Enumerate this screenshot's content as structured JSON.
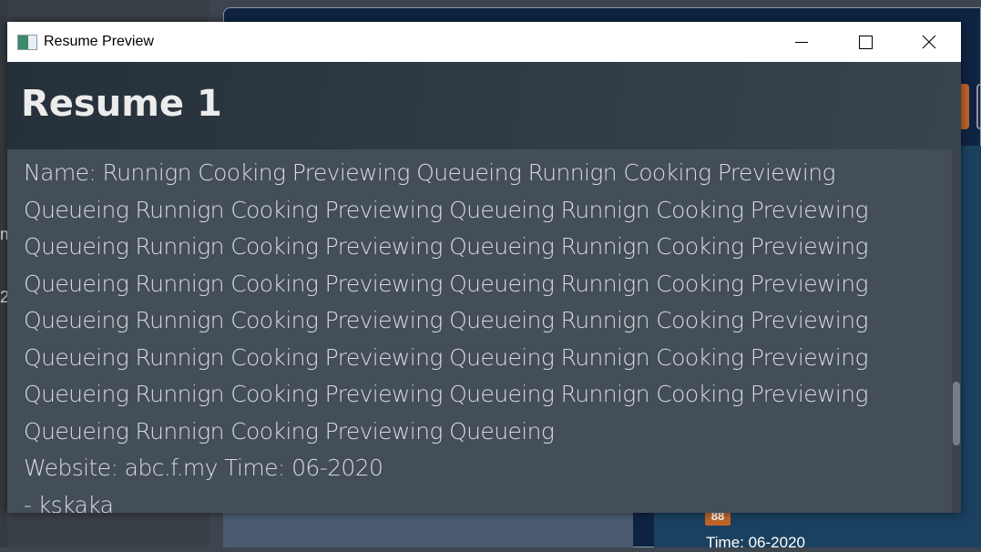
{
  "window": {
    "title": "Resume Preview",
    "minimize": "minimize",
    "maximize": "maximize",
    "close": "close"
  },
  "header": {
    "title": "Resume 1"
  },
  "content": {
    "lines": [
      "Name: Runnign Cooking Previewing Queueing Runnign Cooking Previewing",
      "Queueing Runnign Cooking Previewing Queueing Runnign Cooking Previewing",
      "Queueing Runnign Cooking Previewing Queueing Runnign Cooking Previewing",
      "Queueing Runnign Cooking Previewing Queueing Runnign Cooking Previewing",
      "Queueing Runnign Cooking Previewing Queueing Runnign Cooking Previewing",
      "Queueing Runnign Cooking Previewing Queueing Runnign Cooking Previewing",
      "Queueing Runnign Cooking Previewing Queueing Runnign Cooking Previewing",
      "Queueing Runnign Cooking Previewing Queueing",
      "Website: abc.f.my Time: 06-2020",
      "- kskaka"
    ]
  },
  "background": {
    "frag1": "m",
    "frag2": "2",
    "badge": "88",
    "time": "Time: 06-2020"
  },
  "colors": {
    "accent": "#c0652b",
    "header": "#2c3640",
    "content": "#444e58"
  }
}
